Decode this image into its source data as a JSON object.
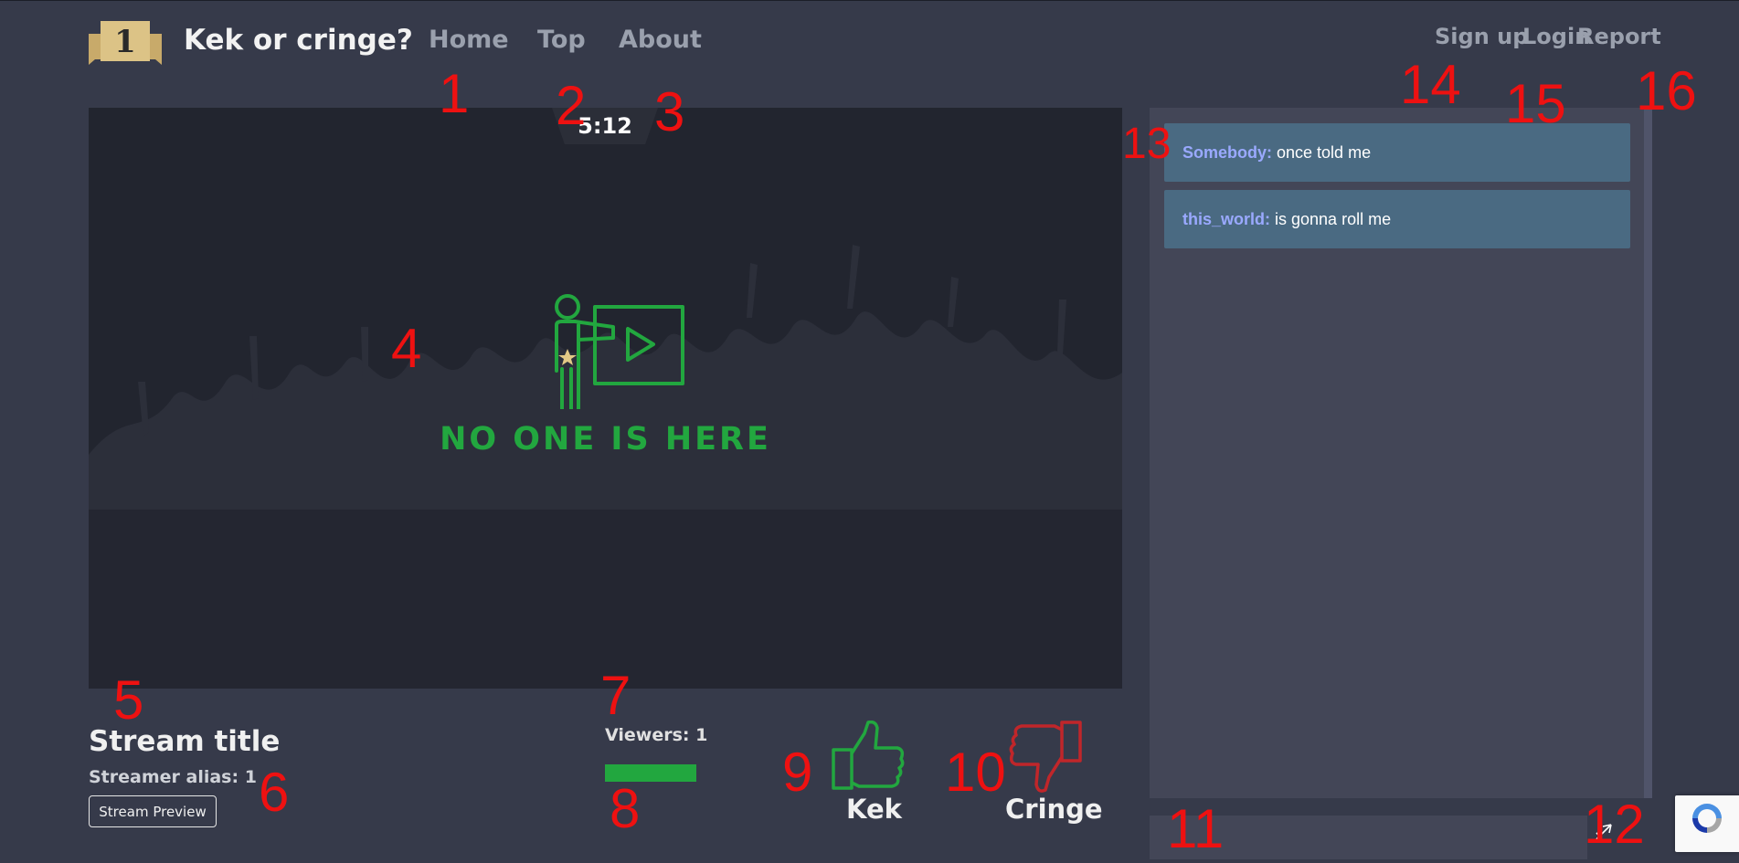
{
  "header": {
    "logo_badge": "1",
    "brand": "Kek or cringe?",
    "nav": {
      "home": "Home",
      "top": "Top",
      "about": "About"
    },
    "sign_up": "Sign up",
    "login": "Login",
    "report": "Report"
  },
  "video": {
    "timer": "5:12",
    "placeholder_text": "NO ONE IS HERE",
    "placeholder_icon": "presenter-play-icon"
  },
  "stream": {
    "title": "Stream title",
    "alias": "Streamer alias: 1",
    "preview_button": "Stream Preview",
    "viewers": "Viewers: 1"
  },
  "vote": {
    "kek": "Kek",
    "cringe": "Cringe"
  },
  "chat": {
    "messages": [
      {
        "author": "Somebody:",
        "text": " once told me"
      },
      {
        "author": "this_world:",
        "text": " is gonna roll me"
      }
    ],
    "input_value": ""
  },
  "colors": {
    "background": "#363a4a",
    "accent_green": "#22a73f",
    "cringe_red": "#c0262a",
    "author_blue": "#9aa9ff",
    "chat_bubble": "#4a6a82",
    "marker_red": "#ee1111"
  },
  "markers": [
    "1",
    "2",
    "3",
    "4",
    "5",
    "6",
    "7",
    "8",
    "9",
    "10",
    "11",
    "12",
    "13",
    "14",
    "15",
    "16"
  ]
}
